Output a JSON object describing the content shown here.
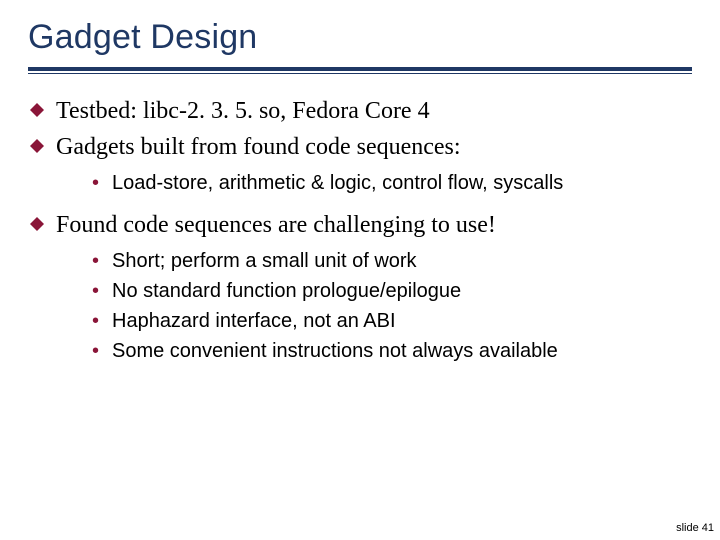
{
  "title": "Gadget Design",
  "bullets": {
    "b1": "Testbed: libc-2. 3. 5. so, Fedora Core 4",
    "b2": "Gadgets built from found code sequences:",
    "b2_sub": {
      "s1": "Load-store, arithmetic & logic, control flow, syscalls"
    },
    "b3": "Found code sequences are challenging to use!",
    "b3_sub": {
      "s1": "Short; perform a small unit of work",
      "s2": "No standard function prologue/epilogue",
      "s3": "Haphazard interface, not an ABI",
      "s4": "Some convenient instructions not always available"
    }
  },
  "footer": "slide 41",
  "colors": {
    "title": "#1f3864",
    "rule": "#1f3864",
    "diamond": "#8a1538",
    "bullet": "#8a1538"
  }
}
